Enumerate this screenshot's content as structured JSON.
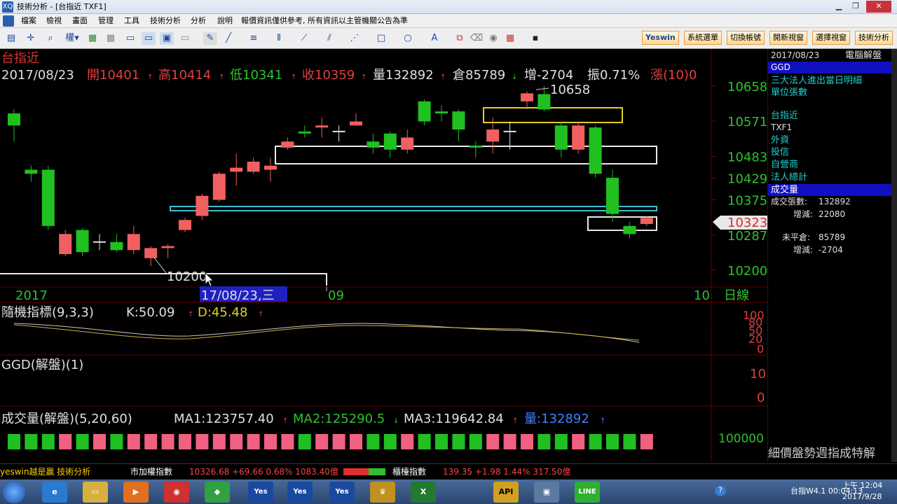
{
  "window": {
    "title": "技術分析 - [台指近 TXF1]",
    "app_icon": "XQ"
  },
  "menu": [
    "檔案",
    "檢視",
    "畫面",
    "管理",
    "工具",
    "技術分析",
    "分析",
    "說明",
    "報價資訊僅供參考, 所有資訊以主管機關公告為準"
  ],
  "toolbar_right": [
    "Yeswin",
    "系統選單",
    "切換帳號",
    "開新視窗",
    "選擇視窗",
    "技術分析"
  ],
  "chart_header": {
    "symbol": "台指近",
    "date": "2017/08/23",
    "open": "開10401",
    "high": "高10414",
    "low": "低10341",
    "close": "收10359",
    "volume": "量132892",
    "oi": "倉85789",
    "change": "增-2704",
    "amp": "振0.71%",
    "up": "漲(10)0"
  },
  "price_axis": [
    "10658",
    "10571",
    "10483",
    "10429",
    "10375",
    "10287",
    "10200"
  ],
  "current_price": "10323",
  "annotations": {
    "high": "10658",
    "low": "10200"
  },
  "time_axis": {
    "year": "2017",
    "cursor": "17/08/23,三",
    "m09": "09",
    "m10": "10",
    "period": "日線"
  },
  "kd": {
    "label": "隨機指標(9,3,3)",
    "k": "K:50.09",
    "d": "D:45.48",
    "ticks": [
      "100",
      "80",
      "50",
      "20",
      "0"
    ]
  },
  "ggd": {
    "label": "GGD(解盤)(1)",
    "ticks": [
      "10",
      "0"
    ]
  },
  "vol": {
    "label": "成交量(解盤)(5,20,60)",
    "ma1": "MA1:123757.40",
    "ma2": "MA2:125290.5",
    "ma3": "MA3:119642.84",
    "q": "量:132892",
    "tick": "100000"
  },
  "side": {
    "date": "2017/08/23",
    "title": "電腦解盤",
    "ggd": "GGD",
    "l1": "三大法人進出當日明細",
    "l2": "單位張數",
    "l3": "台指近",
    "l4": "TXF1",
    "l5": "外資",
    "l6": "投信",
    "l7": "自營商",
    "l8": "法人總計",
    "l9": "成交量",
    "vol_label": "成交張數:",
    "vol_val": "132892",
    "vchg_label": "增減:",
    "vchg_val": "22080",
    "oi_label": "未平倉:",
    "oi_val": "85789",
    "oichg_label": "增減:",
    "oichg_val": "-2704",
    "marquee": "細價盤勢週指成特解"
  },
  "ticker": {
    "brand": "yeswin越是贏 技術分析",
    "tw_label": "市加權指數",
    "tw_val": "10326.68 +69.66 0.68% 1083.40億",
    "otc_label": "櫃檯指數",
    "otc_val": "139.35 +1.98 1.44% 317.50億"
  },
  "taskbar": {
    "clock_time": "上午 12:04",
    "clock_date": "2017/9/28",
    "tray": "台指W4.1 00:04:13",
    "apps": [
      "IE",
      "Folder",
      "Media",
      "Chrome",
      "App",
      "Yeswin",
      "Yeswin",
      "Yeswin",
      "Crown",
      "Excel",
      "API",
      "PC",
      "LINE"
    ]
  },
  "chart_data": {
    "type": "candlestick",
    "title": "台指近",
    "yaxis_ticks": [
      10658,
      10571,
      10483,
      10429,
      10375,
      10287,
      10200
    ],
    "candles": [
      {
        "o": 10590,
        "c": 10560,
        "h": 10600,
        "l": 10520
      },
      {
        "o": 10450,
        "c": 10440,
        "h": 10460,
        "l": 10420
      },
      {
        "o": 10450,
        "c": 10310,
        "h": 10460,
        "l": 10300
      },
      {
        "o": 10240,
        "c": 10290,
        "h": 10300,
        "l": 10235
      },
      {
        "o": 10300,
        "c": 10245,
        "h": 10305,
        "l": 10235
      },
      {
        "o": 10270,
        "c": 10270,
        "h": 10290,
        "l": 10250
      },
      {
        "o": 10270,
        "c": 10250,
        "h": 10290,
        "l": 10245
      },
      {
        "o": 10250,
        "c": 10290,
        "h": 10310,
        "l": 10240
      },
      {
        "o": 10230,
        "c": 10255,
        "h": 10260,
        "l": 10210
      },
      {
        "o": 10255,
        "c": 10260,
        "h": 10265,
        "l": 10230
      },
      {
        "o": 10300,
        "c": 10325,
        "h": 10330,
        "l": 10295
      },
      {
        "o": 10335,
        "c": 10385,
        "h": 10390,
        "l": 10325
      },
      {
        "o": 10375,
        "c": 10440,
        "h": 10445,
        "l": 10370
      },
      {
        "o": 10445,
        "c": 10455,
        "h": 10490,
        "l": 10410
      },
      {
        "o": 10445,
        "c": 10470,
        "h": 10480,
        "l": 10440
      },
      {
        "o": 10450,
        "c": 10460,
        "h": 10480,
        "l": 10420
      },
      {
        "o": 10505,
        "c": 10520,
        "h": 10530,
        "l": 10500
      },
      {
        "o": 10545,
        "c": 10540,
        "h": 10560,
        "l": 10530
      },
      {
        "o": 10555,
        "c": 10560,
        "h": 10580,
        "l": 10530
      },
      {
        "o": 10545,
        "c": 10545,
        "h": 10560,
        "l": 10520
      },
      {
        "o": 10560,
        "c": 10570,
        "h": 10590,
        "l": 10560
      },
      {
        "o": 10520,
        "c": 10505,
        "h": 10540,
        "l": 10490
      },
      {
        "o": 10540,
        "c": 10500,
        "h": 10545,
        "l": 10480
      },
      {
        "o": 10500,
        "c": 10530,
        "h": 10550,
        "l": 10490
      },
      {
        "o": 10620,
        "c": 10570,
        "h": 10625,
        "l": 10560
      },
      {
        "o": 10595,
        "c": 10590,
        "h": 10610,
        "l": 10570
      },
      {
        "o": 10595,
        "c": 10550,
        "h": 10600,
        "l": 10520
      },
      {
        "o": 10510,
        "c": 10505,
        "h": 10520,
        "l": 10480
      },
      {
        "o": 10520,
        "c": 10550,
        "h": 10580,
        "l": 10490
      },
      {
        "o": 10545,
        "c": 10545,
        "h": 10570,
        "l": 10500
      },
      {
        "o": 10620,
        "c": 10640,
        "h": 10645,
        "l": 10600
      },
      {
        "o": 10638,
        "c": 10600,
        "h": 10658,
        "l": 10595
      },
      {
        "o": 10560,
        "c": 10500,
        "h": 10570,
        "l": 10480
      },
      {
        "o": 10500,
        "c": 10560,
        "h": 10570,
        "l": 10490
      },
      {
        "o": 10555,
        "c": 10440,
        "h": 10560,
        "l": 10430
      },
      {
        "o": 10430,
        "c": 10340,
        "h": 10450,
        "l": 10320
      },
      {
        "o": 10310,
        "c": 10290,
        "h": 10320,
        "l": 10280
      },
      {
        "o": 10315,
        "c": 10330,
        "h": 10335,
        "l": 10310
      }
    ],
    "volume": [
      1,
      1,
      1,
      1,
      1,
      1,
      1,
      1,
      1,
      1,
      1,
      1,
      1,
      1,
      1,
      1,
      1,
      1,
      1,
      1,
      1,
      1,
      1,
      1,
      1,
      1,
      1,
      1,
      1,
      1,
      1,
      1,
      1,
      1,
      1,
      1,
      1,
      1
    ],
    "xlabel": "",
    "ylabel": ""
  }
}
